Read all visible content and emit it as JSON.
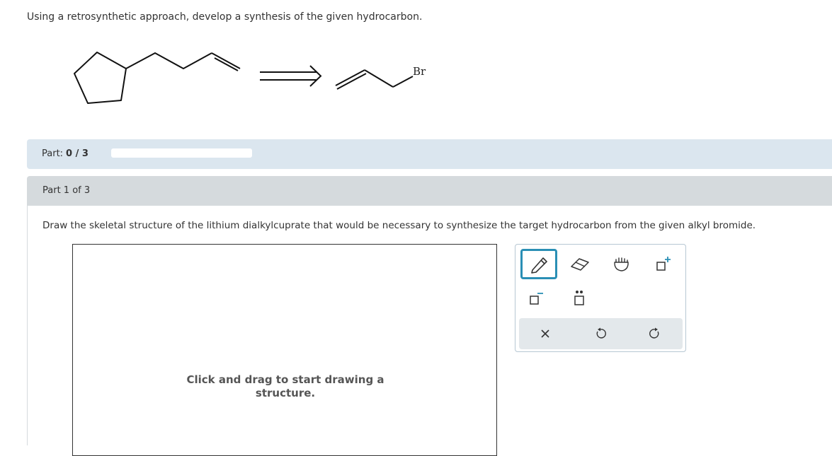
{
  "question": {
    "text": "Using a retrosynthetic approach, develop a synthesis of the given hydrocarbon."
  },
  "scheme": {
    "bromine_label": "Br"
  },
  "progress": {
    "label": "Part:",
    "value": "0 / 3",
    "fraction": 0
  },
  "part": {
    "header": "Part 1 of 3",
    "instruction": "Draw the skeletal structure of the lithium dialkylcuprate that would be necessary to synthesize the target hydrocarbon from the given alkyl bromide."
  },
  "canvas": {
    "hint_line1": "Click and drag to start drawing a",
    "hint_line2": "structure."
  },
  "toolbox": {
    "tools": [
      "pencil-icon",
      "eraser-icon",
      "hand-icon",
      "plus-charge-icon",
      "minus-charge-icon",
      "lone-pair-icon"
    ],
    "actions": [
      "clear-icon",
      "undo-icon",
      "redo-icon"
    ],
    "accent_color": "#2a8fb5"
  }
}
